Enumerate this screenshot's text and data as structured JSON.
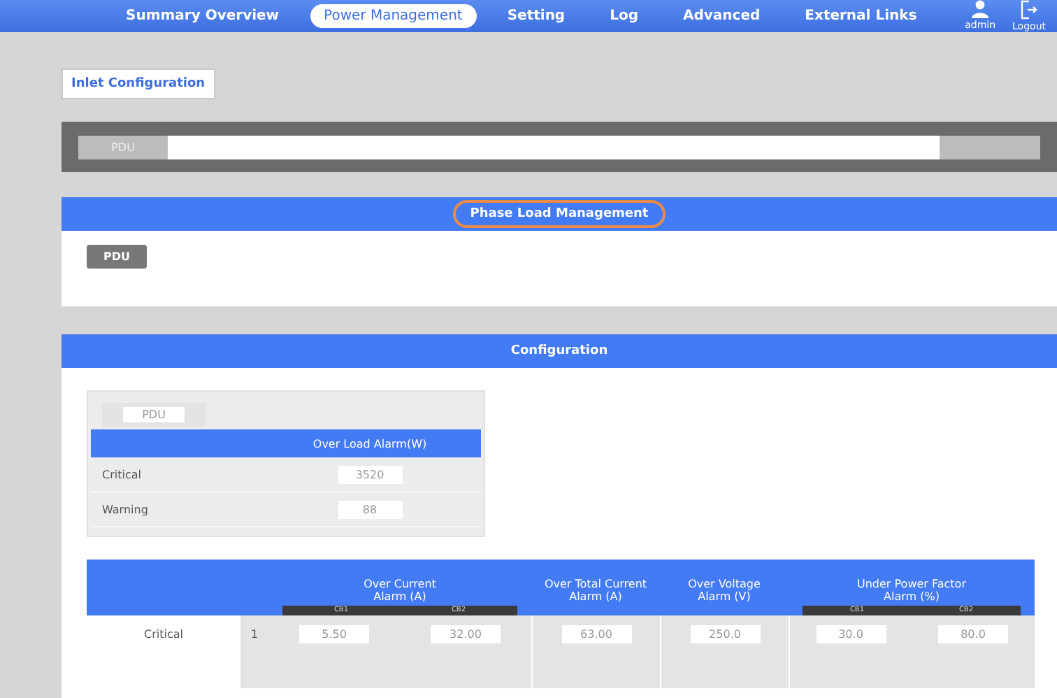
{
  "nav": {
    "items": [
      {
        "label": "Summary Overview",
        "selected": false
      },
      {
        "label": "Power Management",
        "selected": true
      },
      {
        "label": "Setting",
        "selected": false
      },
      {
        "label": "Log",
        "selected": false
      },
      {
        "label": "Advanced",
        "selected": false
      },
      {
        "label": "External Links",
        "selected": false
      }
    ],
    "user": "admin",
    "logout": "Logout"
  },
  "tab": "Inlet Configuration",
  "device_bar": {
    "label": "PDU"
  },
  "phase_load": {
    "title": "Phase Load Management",
    "device": "PDU"
  },
  "configuration": {
    "title": "Configuration",
    "load_box": {
      "device": "PDU",
      "header": "Over Load Alarm(W)",
      "rows": [
        {
          "label": "Critical",
          "value": "3520"
        },
        {
          "label": "Warning",
          "value": "88"
        }
      ]
    },
    "alarm_table": {
      "columns": [
        {
          "title": "Over Current\nAlarm (A)",
          "subs": [
            "CB1",
            "CB2"
          ]
        },
        {
          "title": "Over Total Current\nAlarm (A)"
        },
        {
          "title": "Over Voltage\nAlarm (V)"
        },
        {
          "title": "Under Power Factor\nAlarm (%)",
          "subs": [
            "CB1",
            "CB2"
          ]
        }
      ],
      "rows": [
        {
          "label": "Critical",
          "index": "1",
          "values": [
            "5.50",
            "32.00",
            "63.00",
            "250.0",
            "30.0",
            "80.0"
          ]
        }
      ]
    }
  }
}
